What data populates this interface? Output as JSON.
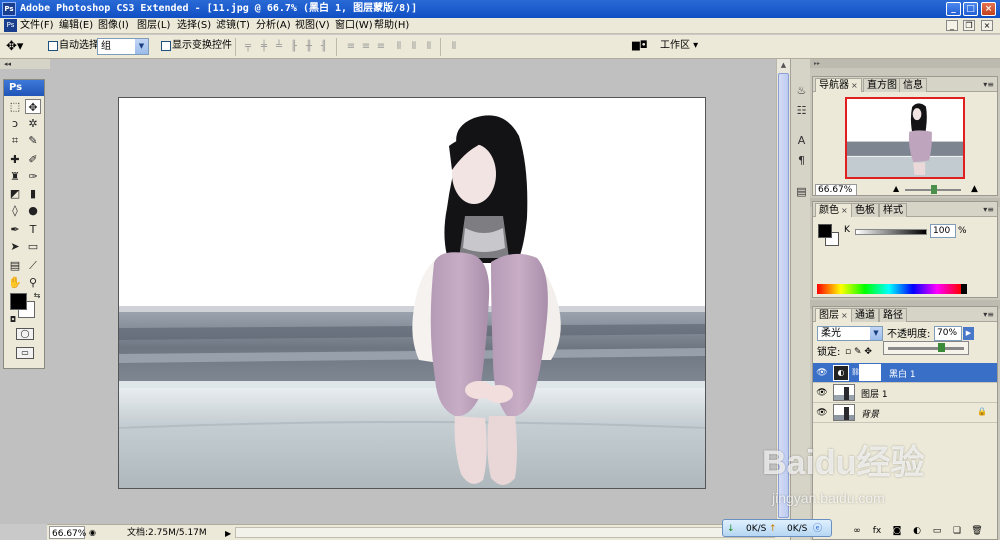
{
  "window": {
    "app_logo": "Ps",
    "title": "Adobe Photoshop CS3 Extended - [11.jpg @ 66.7% (黑白 1, 图层蒙版/8)]",
    "minimize": "_",
    "maximize": "□",
    "close": "×"
  },
  "menu": {
    "items": [
      "文件(F)",
      "编辑(E)",
      "图像(I)",
      "图层(L)",
      "选择(S)",
      "滤镜(T)",
      "分析(A)",
      "视图(V)",
      "窗口(W)",
      "帮助(H)"
    ],
    "doc_minimize": "_",
    "doc_restore": "❐",
    "doc_close": "×"
  },
  "options": {
    "auto_select_label": "自动选择:",
    "auto_select_value": "组",
    "show_transform_label": "显示变换控件",
    "workspace_label": "工作区 ▾"
  },
  "toolbox": {
    "header": "Ps"
  },
  "status": {
    "zoom": "66.67%",
    "doc_size": "文档:2.75M/5.17M"
  },
  "navigator": {
    "tabs": [
      "导航器",
      "直方图",
      "信息"
    ],
    "zoom": "66.67%"
  },
  "color_panel": {
    "tabs": [
      "颜色",
      "色板",
      "样式"
    ],
    "channel_label": "K",
    "k_value": "100",
    "k_unit": "%"
  },
  "layers_panel": {
    "tabs": [
      "图层",
      "通道",
      "路径"
    ],
    "blend_mode": "柔光",
    "opacity_label": "不透明度:",
    "opacity_value": "70%",
    "opacity_fraction": 0.7,
    "lock_label": "锁定:",
    "layers": [
      {
        "name": "黑白 1",
        "selected": true
      },
      {
        "name": "图层 1",
        "selected": false
      },
      {
        "name": "背景",
        "selected": false,
        "locked": true
      }
    ]
  },
  "network": {
    "down": "0K/S",
    "up": "0K/S"
  },
  "watermark": {
    "main": "Baidu经验",
    "sub": "jingyan.baidu.com"
  },
  "colors": {
    "title_bar": "#1a5bd0",
    "selected_layer": "#3a6fc8"
  }
}
